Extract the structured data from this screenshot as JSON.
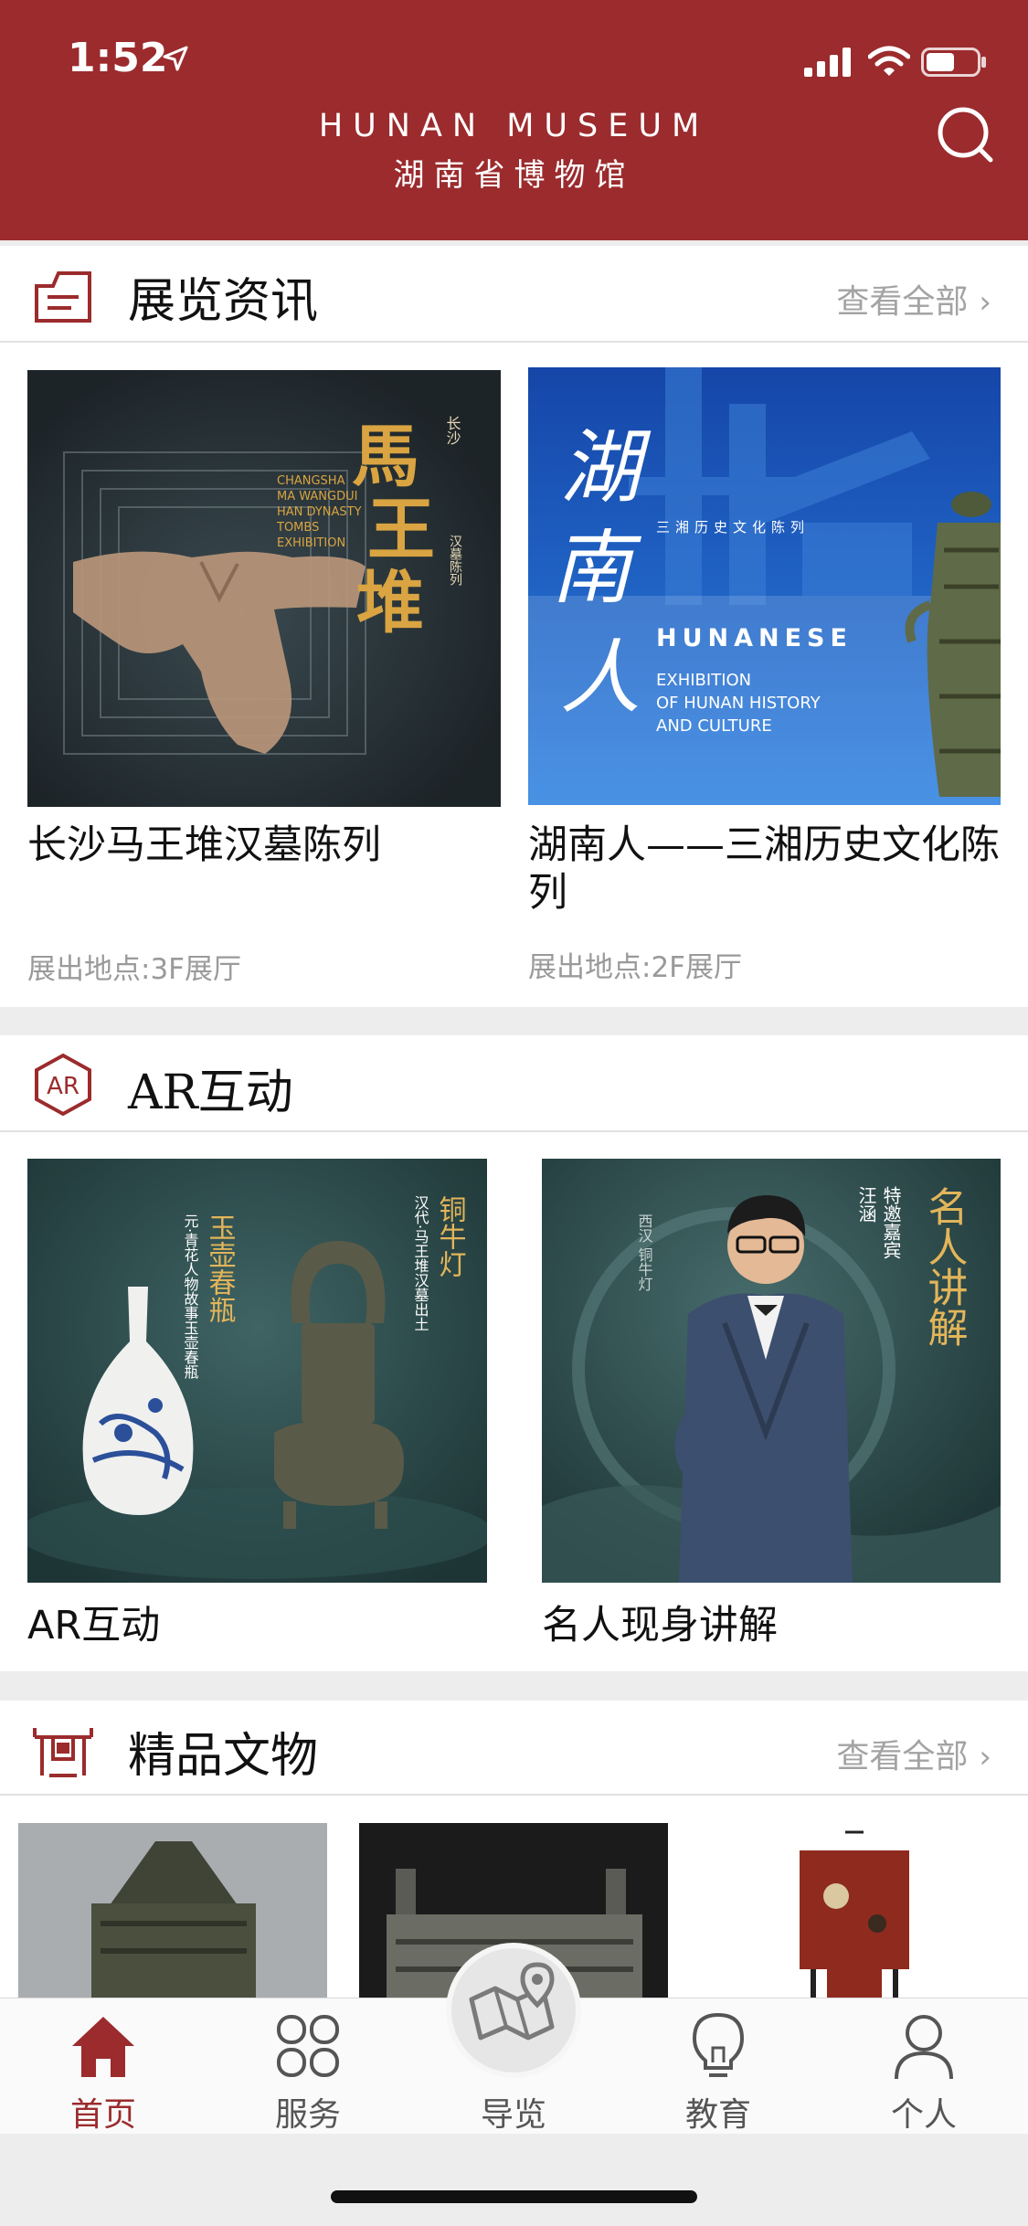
{
  "status_bar": {
    "time": "1:52"
  },
  "header": {
    "brand_en": "HUNAN MUSEUM",
    "brand_cn": "湖南省博物馆",
    "search_icon": "search-icon"
  },
  "exhibitions": {
    "title": "展览资讯",
    "see_all": "查看全部",
    "items": [
      {
        "title": "长沙马王堆汉墓陈列",
        "location": "展出地点:3F展厅",
        "poster": {
          "big": [
            "馬",
            "王",
            "堆"
          ],
          "small_top": "长沙",
          "side": "汉墓陈列",
          "en": [
            "CHANGSHA",
            "MA WANGDUI",
            "HAN DYNASTY",
            "TOMBS",
            "EXHIBITION"
          ]
        }
      },
      {
        "title": "湖南人——三湘历史文化陈列",
        "location": "展出地点:2F展厅",
        "poster": {
          "big": [
            "湖",
            "南",
            "人"
          ],
          "tag": "三湘历史文化陈列",
          "en_title": "HUNANESE",
          "en": [
            "EXHIBITION",
            "OF HUNAN HISTORY",
            "AND CULTURE"
          ]
        }
      }
    ]
  },
  "ar": {
    "title": "AR互动",
    "icon_label": "AR",
    "items": [
      {
        "title": "AR互动",
        "poster": {
          "left_title": "玉壶春瓶",
          "left_sub": "元·青花人物故事玉壶春瓶",
          "right_title": "铜牛灯",
          "right_sub": "汉代·马王堆汉墓出土"
        }
      },
      {
        "title": "名人现身讲解",
        "poster": {
          "big": "名人讲解",
          "guest": "特邀嘉宾",
          "name": "汪涵",
          "side": "西汉 铜牛灯"
        }
      }
    ]
  },
  "relics": {
    "title": "精品文物",
    "see_all": "查看全部"
  },
  "tabs": [
    {
      "label": "首页",
      "icon": "home-icon",
      "active": true
    },
    {
      "label": "服务",
      "icon": "services-grid-icon",
      "active": false
    },
    {
      "label": "导览",
      "icon": "guide-map-icon",
      "active": false
    },
    {
      "label": "教育",
      "icon": "lightbulb-icon",
      "active": false
    },
    {
      "label": "个人",
      "icon": "person-icon",
      "active": false
    }
  ],
  "colors": {
    "brand": "#9b2b2d",
    "muted": "#9a9a9a",
    "gold": "#d9a441"
  }
}
